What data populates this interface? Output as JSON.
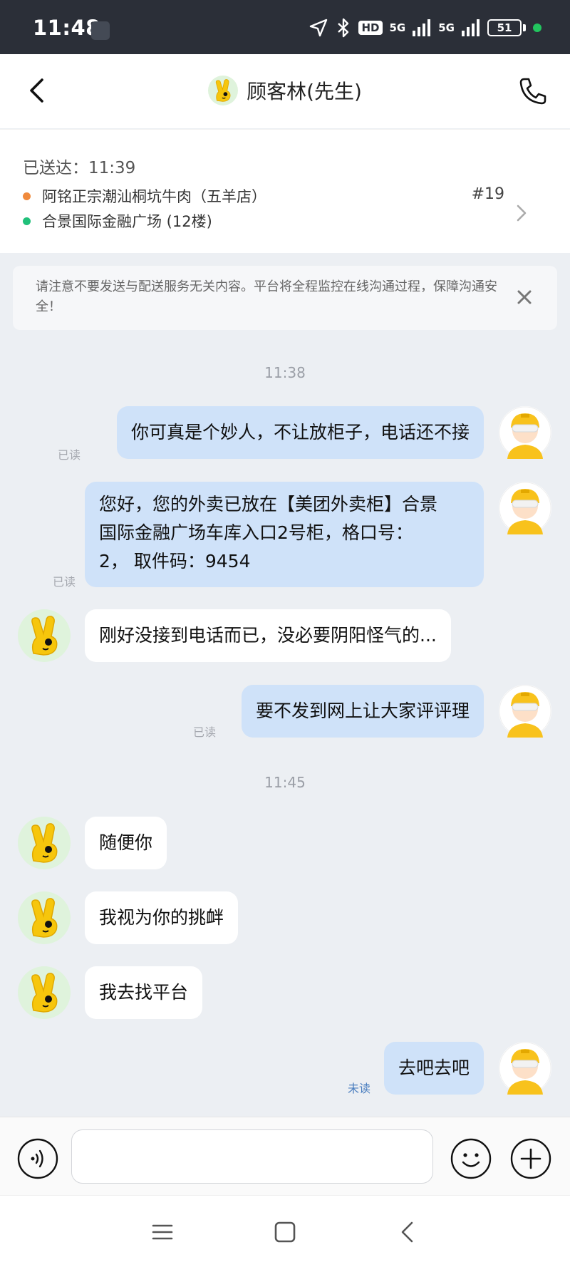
{
  "status_bar": {
    "time": "11:48",
    "hd_label": "HD",
    "network_1": "5G",
    "network_2": "5G",
    "battery": "51"
  },
  "header": {
    "title": "顾客林(先生)"
  },
  "order": {
    "delivered_label": "已送达：11:39",
    "pickup_store": "阿铭正宗潮汕桐坑牛肉（五羊店）",
    "destination": "合景国际金融广场 (12楼)",
    "order_number": "#19",
    "pickup_dot_color": "#f08a3c",
    "destination_dot_color": "#21c07a"
  },
  "notice": {
    "text": "请注意不要发送与配送服务无关内容。平台将全程监控在线沟通过程，保障沟通安全！"
  },
  "chat": {
    "timestamps": [
      "11:38",
      "11:45"
    ],
    "messages": [
      {
        "direction": "out",
        "text": "你可真是个妙人，不让放柜子，电话还不接",
        "status": "已读"
      },
      {
        "direction": "out",
        "lines": [
          "您好，您的外卖已放在【美团外卖柜】合景",
          "国际金融广场车库入口2号柜，格口号：",
          "2， 取件码：9454"
        ],
        "status": "已读"
      },
      {
        "direction": "in",
        "text": "刚好没接到电话而已，没必要阴阳怪气的..."
      },
      {
        "direction": "out",
        "text": "要不发到网上让大家评评理",
        "status": "已读"
      },
      {
        "direction": "in",
        "text": "随便你"
      },
      {
        "direction": "in",
        "text": "我视为你的挑衅"
      },
      {
        "direction": "in",
        "text": "我去找平台"
      },
      {
        "direction": "out",
        "text": "去吧去吧",
        "status": "未读"
      }
    ]
  },
  "colors": {
    "outgoing_bubble": "#cfe2f9",
    "incoming_bubble": "#ffffff",
    "chat_background": "#eceff3",
    "unread_status": "#4a7ebf"
  },
  "icons": {
    "back": "chevron-left-icon",
    "phone": "phone-icon",
    "chevron": "chevron-right-icon",
    "close": "close-icon",
    "voice": "voice-icon",
    "emoji": "emoji-icon",
    "plus": "plus-icon"
  }
}
